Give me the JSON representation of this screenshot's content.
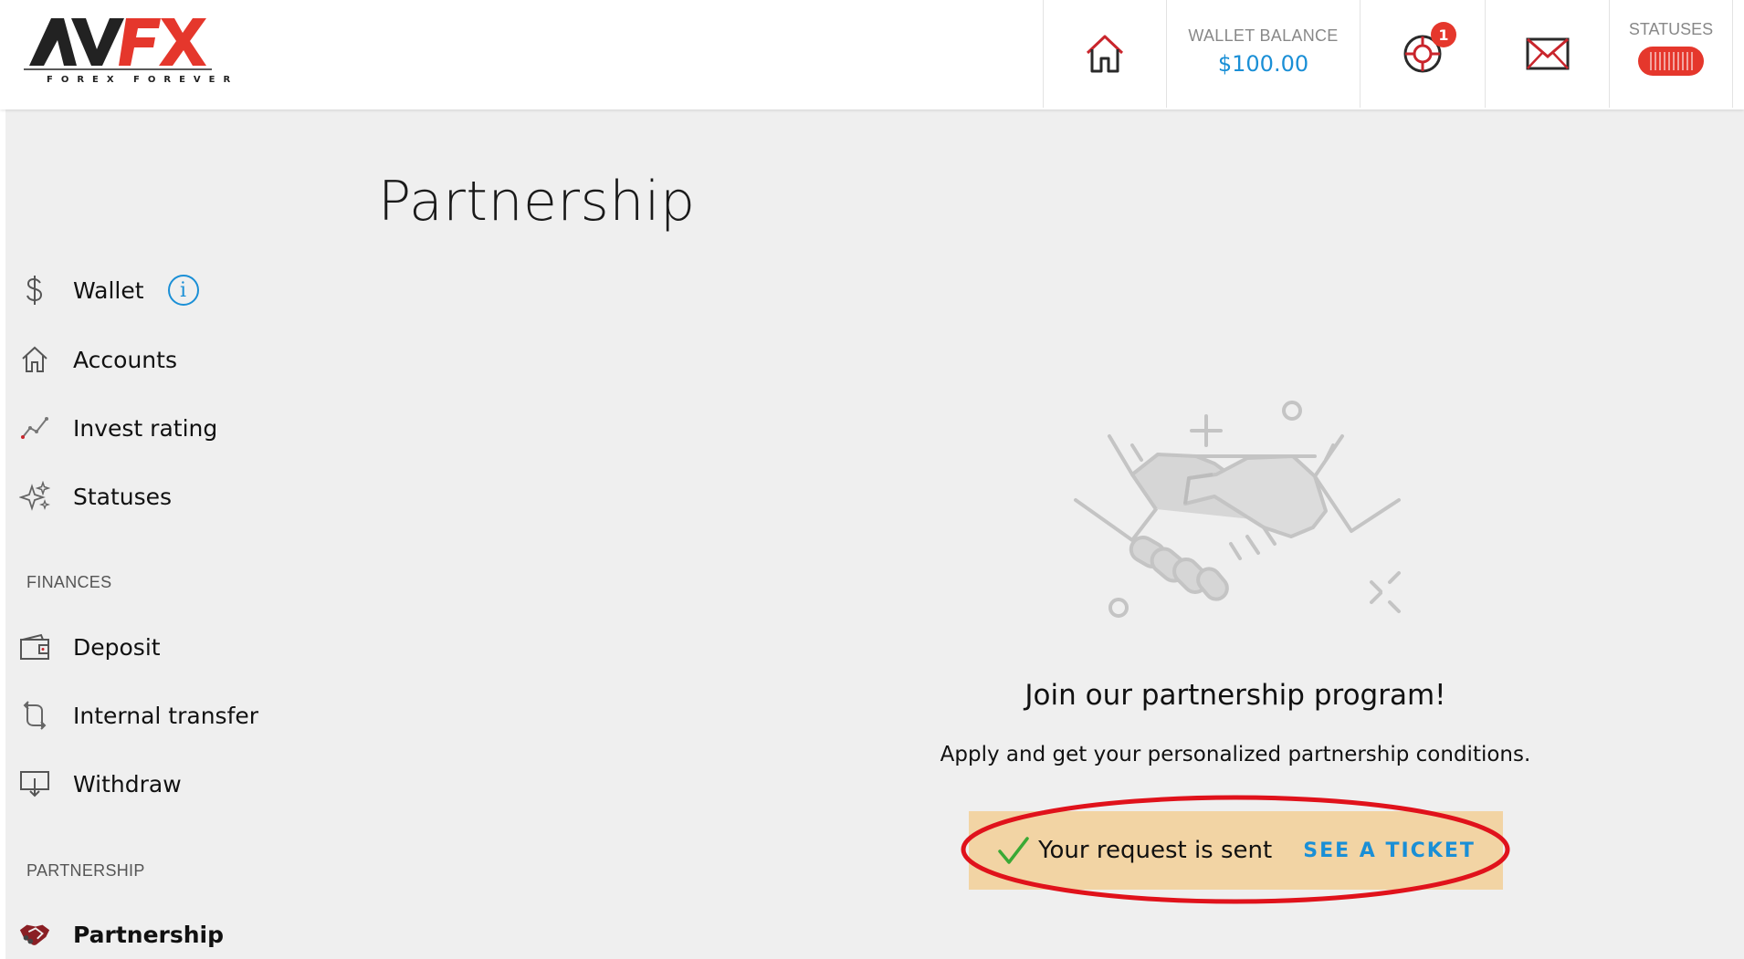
{
  "brand": {
    "logo_text": "AVFX",
    "tagline": "FOREX FOREVER",
    "colors": {
      "dark": "#222222",
      "red": "#e5372c"
    }
  },
  "header": {
    "wallet_label": "WALLET BALANCE",
    "wallet_value": "$100.00",
    "support_badge": "1",
    "statuses_label": "STATUSES",
    "icons": [
      "home-icon",
      "support-lifebuoy-icon",
      "mail-icon"
    ]
  },
  "page": {
    "title": "Partnership"
  },
  "sidebar": {
    "items": [
      {
        "label": "Wallet",
        "icon": "dollar-icon"
      },
      {
        "label": "Accounts",
        "icon": "house-icon"
      },
      {
        "label": "Invest rating",
        "icon": "trend-line-icon"
      },
      {
        "label": "Statuses",
        "icon": "sparkles-icon"
      }
    ],
    "finances_label": "FINANCES",
    "finance_items": [
      {
        "label": "Deposit",
        "icon": "wallet-icon"
      },
      {
        "label": "Internal transfer",
        "icon": "transfer-arrows-icon"
      },
      {
        "label": "Withdraw",
        "icon": "withdraw-tray-icon"
      }
    ],
    "partnership_label": "PARTNERSHIP",
    "partnership_items": [
      {
        "label": "Partnership",
        "icon": "handshake-icon",
        "active": true
      }
    ]
  },
  "main": {
    "promo_title": "Join our partnership program!",
    "promo_subtitle": "Apply and get your personalized partnership conditions.",
    "request_status": "Your request is sent",
    "ticket_link": "SEE A TICKET",
    "colors": {
      "accent": "#1a8fd6",
      "request_bg": "#f2d4a4",
      "check": "#3aa935",
      "highlight": "#e0121b"
    }
  }
}
